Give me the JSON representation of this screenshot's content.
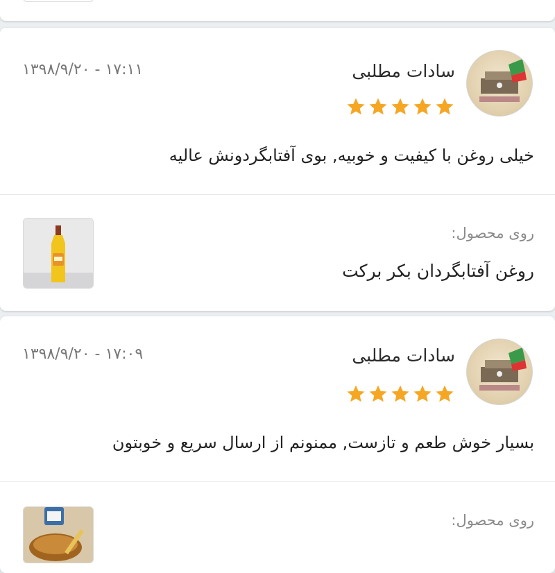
{
  "reviews": [
    {
      "author": "سادات مطلبی",
      "datetime": "۱۷:۱۱ - ۱۳۹۸/۹/۲۰",
      "rating": 5,
      "comment": "خیلی روغن با کیفیت و خوبیه, بوی آفتابگردونش عالیه",
      "product_label": "روی محصول:",
      "product_name": "روغن آفتابگردان بکر برکت",
      "avatar_icon": "author-avatar",
      "thumb_icon": "oil-bottle-thumbnail"
    },
    {
      "author": "سادات مطلبی",
      "datetime": "۱۷:۰۹ - ۱۳۹۸/۹/۲۰",
      "rating": 5,
      "comment": "بسیار خوش طعم و تازست, ممنونم از ارسال سریع و خوبتون",
      "product_label": "روی محصول:",
      "avatar_icon": "author-avatar",
      "thumb_icon": "honey-bowl-thumbnail"
    }
  ],
  "colors": {
    "star": "#f5a623",
    "background": "#eceff1",
    "card": "#ffffff"
  }
}
